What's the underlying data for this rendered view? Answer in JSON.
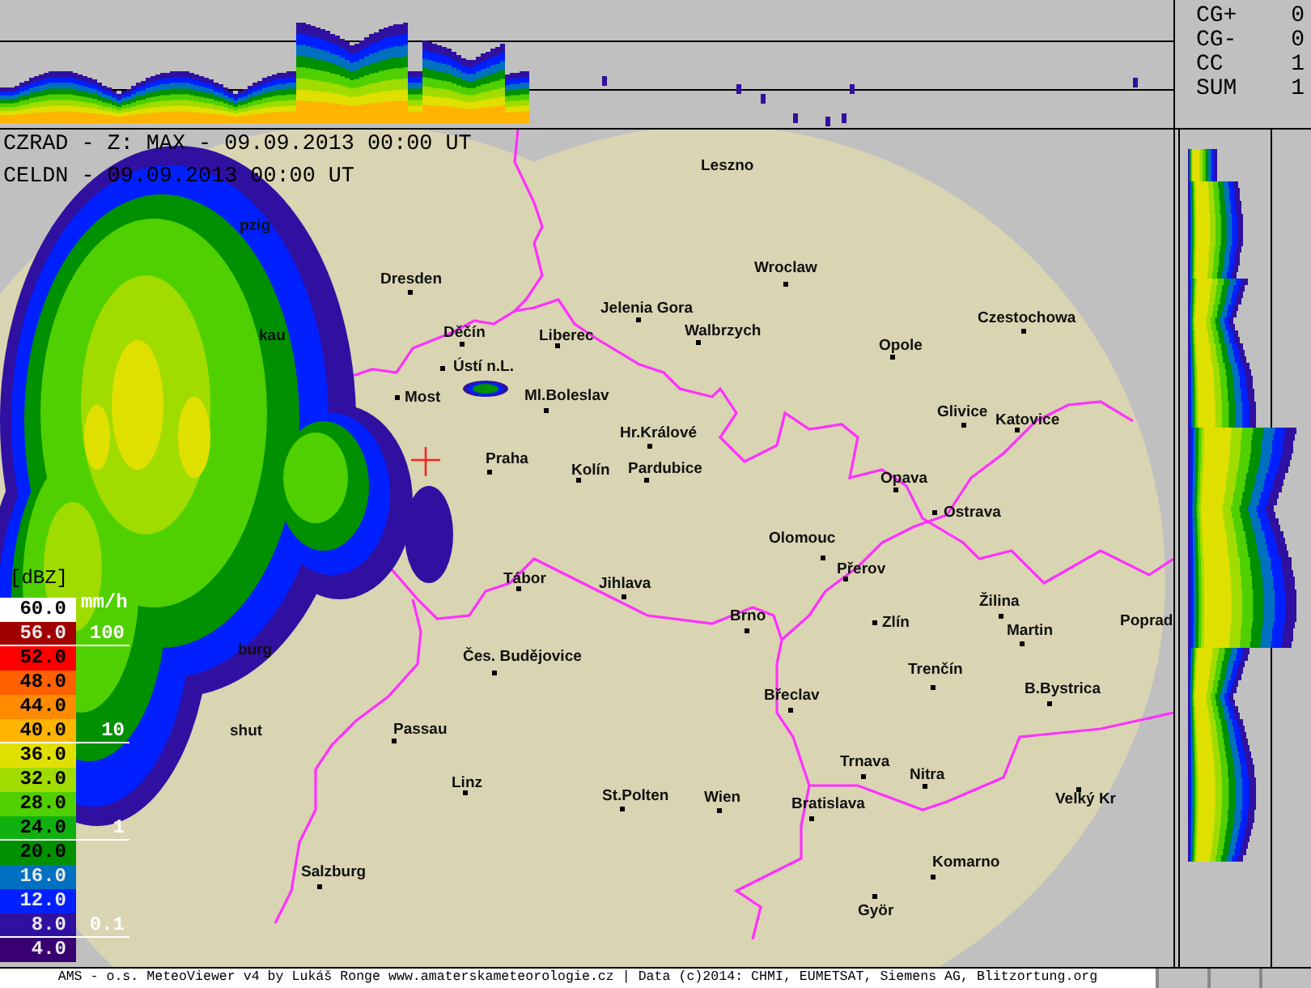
{
  "header": {
    "lines": [
      "CZRAD - Z: MAX - 09.09.2013 00:00 UT",
      "CELDN - 09.09.2013 00:00 UT"
    ]
  },
  "lightning": {
    "rows": [
      {
        "label": "CG+",
        "value": "0"
      },
      {
        "label": "CG-",
        "value": "0"
      },
      {
        "label": "CC",
        "value": "1"
      },
      {
        "label": "SUM",
        "value": "1"
      }
    ]
  },
  "legend": {
    "unit": "[dBZ]",
    "rate_unit": "mm/h",
    "rate_marks": [
      "100",
      "10",
      "1",
      "0.1"
    ],
    "steps": [
      {
        "label": "60.0",
        "color": "#ffffff"
      },
      {
        "label": "56.0",
        "color": "#a00000"
      },
      {
        "label": "52.0",
        "color": "#ff0000"
      },
      {
        "label": "48.0",
        "color": "#ff6000"
      },
      {
        "label": "44.0",
        "color": "#ff8c00"
      },
      {
        "label": "40.0",
        "color": "#ffb400"
      },
      {
        "label": "36.0",
        "color": "#e0e000"
      },
      {
        "label": "32.0",
        "color": "#a0dc00"
      },
      {
        "label": "28.0",
        "color": "#50d000"
      },
      {
        "label": "24.0",
        "color": "#10b010"
      },
      {
        "label": "20.0",
        "color": "#009000"
      },
      {
        "label": "16.0",
        "color": "#0070c0"
      },
      {
        "label": "12.0",
        "color": "#0020ff"
      },
      {
        "label": "8.0",
        "color": "#3010a0"
      },
      {
        "label": "4.0",
        "color": "#380070"
      }
    ]
  },
  "map": {
    "cities": [
      {
        "name": "Leszno"
      },
      {
        "name": "Wroclaw"
      },
      {
        "name": "Dresden"
      },
      {
        "name": "Jelenia Gora"
      },
      {
        "name": "Děčín"
      },
      {
        "name": "Liberec"
      },
      {
        "name": "Ústí n.L."
      },
      {
        "name": "Most"
      },
      {
        "name": "Ml.Boleslav"
      },
      {
        "name": "Walbrzych"
      },
      {
        "name": "Opole"
      },
      {
        "name": "Czestochowa"
      },
      {
        "name": "Glivice"
      },
      {
        "name": "Katovice"
      },
      {
        "name": "Hr.Králové"
      },
      {
        "name": "Praha"
      },
      {
        "name": "Kolín"
      },
      {
        "name": "Pardubice"
      },
      {
        "name": "Opava"
      },
      {
        "name": "Ostrava"
      },
      {
        "name": "Olomouc"
      },
      {
        "name": "Přerov"
      },
      {
        "name": "Tábor"
      },
      {
        "name": "Jihlava"
      },
      {
        "name": "Brno"
      },
      {
        "name": "Zlín"
      },
      {
        "name": "Žilina"
      },
      {
        "name": "Martin"
      },
      {
        "name": "Poprad"
      },
      {
        "name": "Trenčín"
      },
      {
        "name": "B.Bystrica"
      },
      {
        "name": "Čes. Budějovice"
      },
      {
        "name": "Břeclav"
      },
      {
        "name": "Passau"
      },
      {
        "name": "Linz"
      },
      {
        "name": "St.Polten"
      },
      {
        "name": "Wien"
      },
      {
        "name": "Bratislava"
      },
      {
        "name": "Trnava"
      },
      {
        "name": "Nitra"
      },
      {
        "name": "Velký Kr"
      },
      {
        "name": "Komarno"
      },
      {
        "name": "Györ"
      },
      {
        "name": "Salzburg"
      },
      {
        "name": "pzig"
      },
      {
        "name": "kau"
      },
      {
        "name": "burg"
      },
      {
        "name": "shut"
      }
    ]
  },
  "footer": "AMS - o.s. MeteoViewer v4 by Lukáš Ronge www.amaterskameteorologie.cz | Data (c)2014: CHMI, EUMETSAT, Siemens AG, Blitzortung.org"
}
